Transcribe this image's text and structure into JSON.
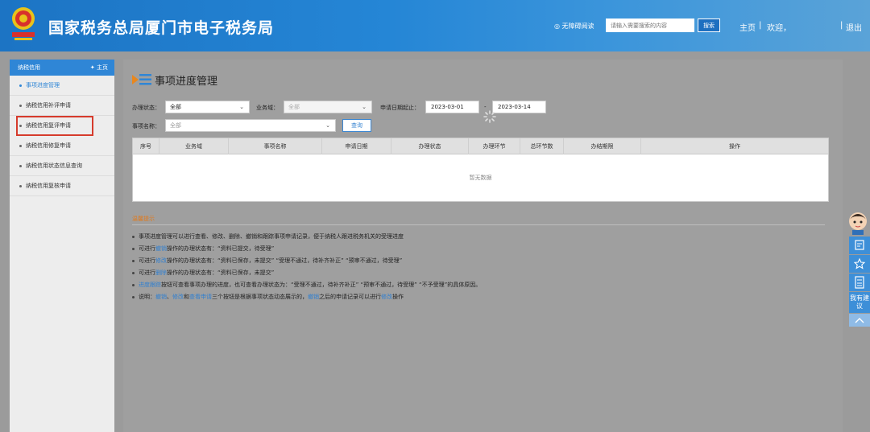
{
  "header": {
    "site_title": "国家税务总局厦门市电子税务局",
    "accessibility": "◎ 无障碍阅读",
    "search_placeholder": "请输入需要搜索的内容",
    "search_button": "搜索",
    "home": "主页",
    "sep": "|",
    "welcome": "欢迎，",
    "logout": "退出"
  },
  "sidebar": {
    "title": "纳税信用",
    "home": "✦ 主页",
    "items": [
      {
        "label": "事项进度管理"
      },
      {
        "label": "纳税信用补评申请"
      },
      {
        "label": "纳税信用复评申请"
      },
      {
        "label": "纳税信用修复申请"
      },
      {
        "label": "纳税信用状态信息查询"
      },
      {
        "label": "纳税信用复核申请"
      }
    ]
  },
  "main": {
    "title": "事项进度管理",
    "filters": {
      "status_label": "办理状态：",
      "status_value": "全部",
      "domain_label": "业务域：",
      "domain_value": "全部",
      "date_label": "申请日期起止：",
      "date_start": "2023-03-01",
      "date_dash": "-",
      "date_end": "2023-03-14",
      "item_label": "事项名称：",
      "item_value": "全部",
      "query": "查询"
    },
    "table": {
      "headers": [
        "序号",
        "业务域",
        "事项名称",
        "申请日期",
        "办理状态",
        "办理环节",
        "总环节数",
        "办结期限",
        "操作"
      ],
      "empty": "暂无数据"
    },
    "tips": {
      "title": "温馨提示",
      "lines": [
        {
          "parts": [
            "事项进度管理可以进行查看、修改、删除、撤销和跟踪事项申请记录，便于纳税人跟进税务机关的受理进度"
          ]
        },
        {
          "parts": [
            "可进行",
            "撤销",
            "操作的办理状态有：“资料已提交，待受理”"
          ]
        },
        {
          "parts": [
            "可进行",
            "修改",
            "操作的办理状态有：“资料已保存，未提交”  “受理不通过，待补齐补正”  “预审不通过，待受理”"
          ]
        },
        {
          "parts": [
            "可进行",
            "删除",
            "操作的办理状态有：“资料已保存，未提交”"
          ]
        },
        {
          "parts": [
            "",
            "进度跟踪",
            "按钮可查看事项办理的进度，也可查看办理状态为：“受理不通过，待补齐补正”  “预审不通过，待受理”  “不予受理”的具体原因。"
          ]
        },
        {
          "parts": [
            "说明：",
            "撤销",
            "、",
            "修改",
            "和",
            "查看申请",
            "三个按钮是根据事项状态动态展示的，",
            "撤销",
            "之后的申请记录可以进行",
            "修改",
            "操作"
          ]
        }
      ]
    }
  },
  "float_bar": {
    "suggest": "我有建议"
  },
  "colors": {
    "header_blue": "#2586d6",
    "accent": "#2f86d6",
    "tips_title": "#e07a1d",
    "highlight_box": "#d63b2c"
  }
}
